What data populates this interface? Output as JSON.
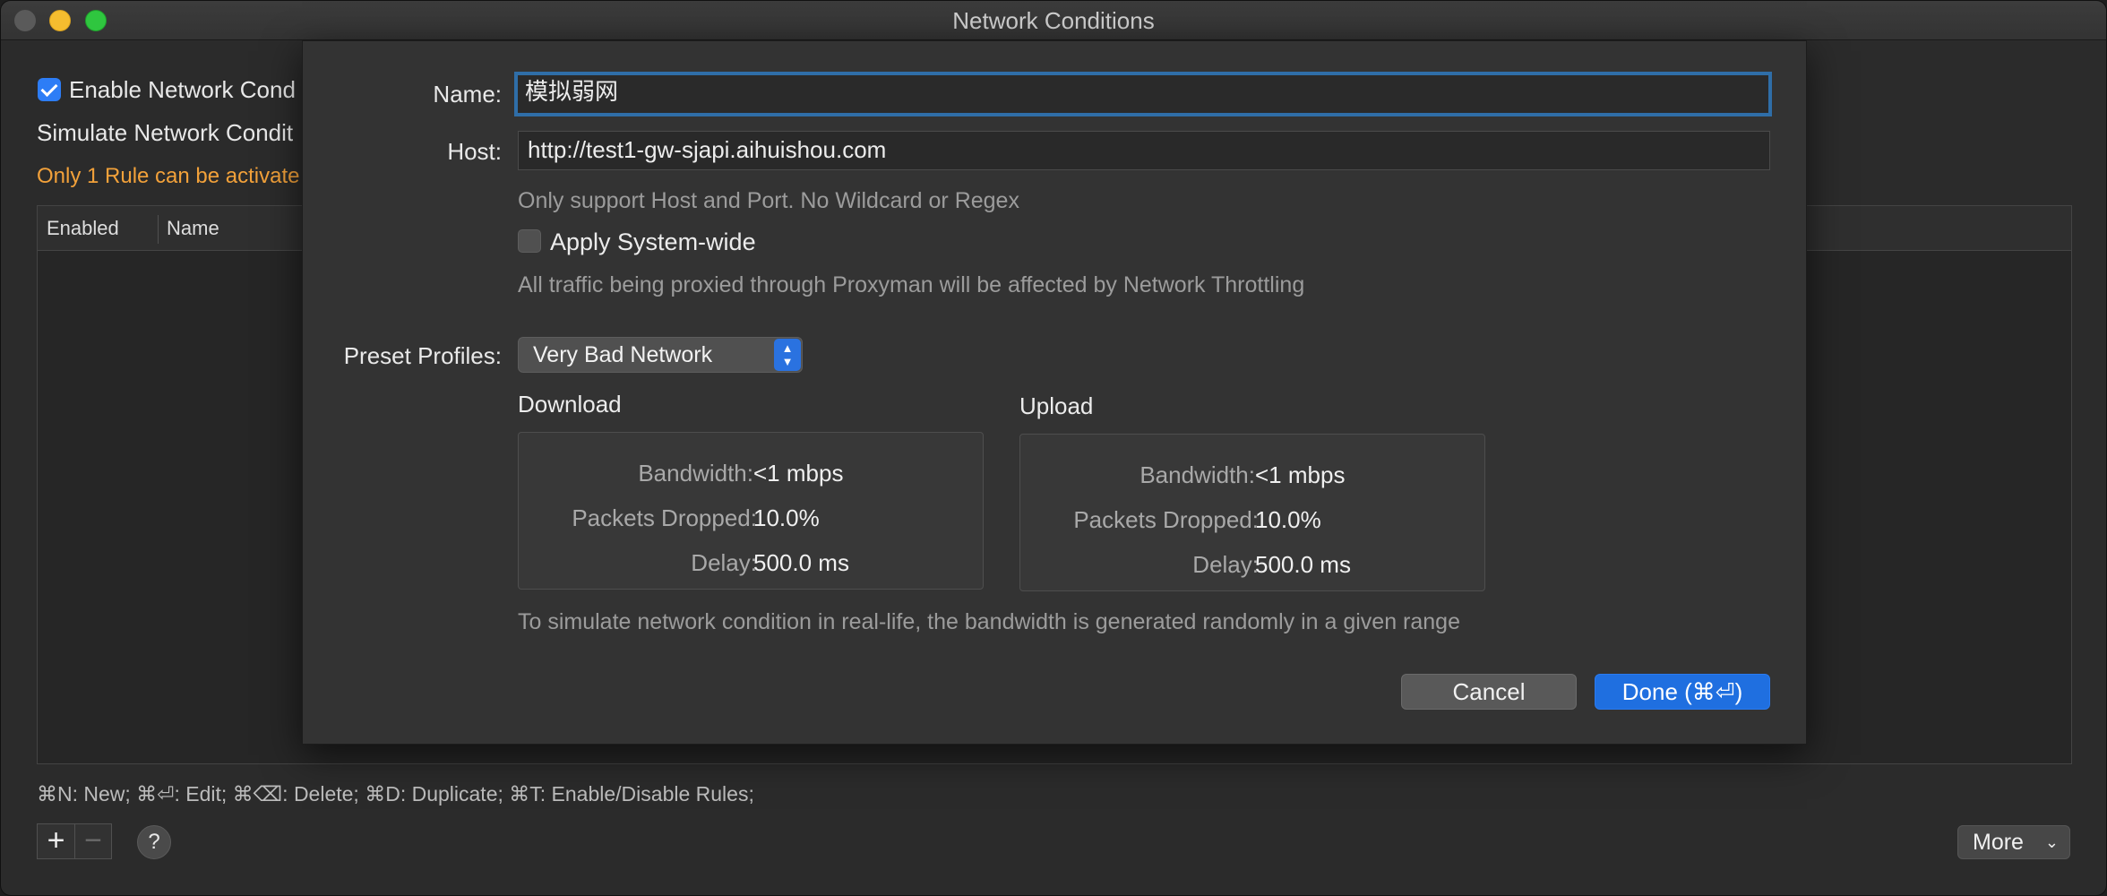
{
  "window": {
    "title": "Network Conditions"
  },
  "background": {
    "enable_label": "Enable Network Cond",
    "simulate_label": "Simulate Network Condit",
    "warning": "Only 1 Rule can be activate",
    "table_headers": [
      "Enabled",
      "Name"
    ],
    "shortcuts_hint": "⌘N: New; ⌘⏎: Edit; ⌘⌫: Delete; ⌘D: Duplicate; ⌘T: Enable/Disable Rules;",
    "add_label": "+",
    "remove_label": "−",
    "help_label": "?",
    "more_label": "More",
    "more_chevron": "⌄"
  },
  "dialog": {
    "name_label": "Name:",
    "name_value": "模拟弱网",
    "host_label": "Host:",
    "host_value": "http://test1-gw-sjapi.aihuishou.com",
    "host_hint": "Only support Host and Port. No Wildcard or Regex",
    "system_wide_label": "Apply System-wide",
    "system_wide_checked": false,
    "system_wide_hint": "All traffic being proxied through Proxyman will be affected by Network Throttling",
    "preset_label": "Preset Profiles:",
    "preset_value": "Very Bad Network",
    "download": {
      "title": "Download",
      "bandwidth_label": "Bandwidth:",
      "bandwidth_value": "<1 mbps",
      "dropped_label": "Packets Dropped:",
      "dropped_value": "10.0%",
      "delay_label": "Delay:",
      "delay_value": "500.0 ms"
    },
    "upload": {
      "title": "Upload",
      "bandwidth_label": "Bandwidth:",
      "bandwidth_value": "<1 mbps",
      "dropped_label": "Packets Dropped:",
      "dropped_value": "10.0%",
      "delay_label": "Delay:",
      "delay_value": "500.0 ms"
    },
    "footnote": "To simulate network condition in real-life, the bandwidth is generated randomly in a given range",
    "cancel_label": "Cancel",
    "done_label": "Done (⌘⏎)"
  },
  "colors": {
    "accent": "#1f6fe0",
    "warning": "#f2a13a",
    "focus_ring": "#2f6ea8"
  }
}
